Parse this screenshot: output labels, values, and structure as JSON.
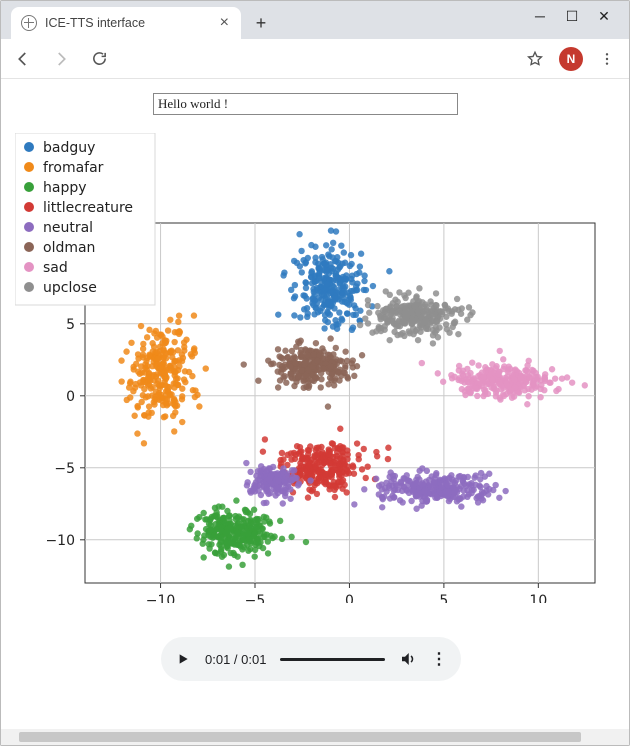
{
  "window": {
    "tab_title": "ICE-TTS interface",
    "avatar_letter": "N"
  },
  "page": {
    "input_value": "Hello world !"
  },
  "audio": {
    "time_display": "0:01 / 0:01"
  },
  "chart_data": {
    "type": "scatter",
    "title": "",
    "xlabel": "",
    "ylabel": "",
    "xlim": [
      -14,
      13
    ],
    "ylim": [
      -13,
      12
    ],
    "x_ticks": [
      -10,
      -5,
      0,
      5,
      10
    ],
    "y_ticks": [
      -10,
      -5,
      0,
      5
    ],
    "grid": true,
    "legend_position": "upper-left",
    "series": [
      {
        "name": "badguy",
        "color": "#2f7abf",
        "center": [
          -1.0,
          7.5
        ],
        "spread": [
          2.0,
          3.0
        ]
      },
      {
        "name": "fromafar",
        "color": "#f08a1a",
        "center": [
          -10.0,
          1.5
        ],
        "spread": [
          1.8,
          3.5
        ]
      },
      {
        "name": "happy",
        "color": "#38a03a",
        "center": [
          -6.0,
          -9.5
        ],
        "spread": [
          2.2,
          1.8
        ]
      },
      {
        "name": "littlecreature",
        "color": "#d23a35",
        "center": [
          -1.5,
          -5.0
        ],
        "spread": [
          2.5,
          1.8
        ]
      },
      {
        "name": "neutral",
        "color": "#8d6cbf",
        "center": [
          4.5,
          -6.5
        ],
        "spread": [
          3.2,
          1.2
        ]
      },
      {
        "name": "oldman",
        "color": "#8b6557",
        "center": [
          -2.0,
          2.0
        ],
        "spread": [
          2.0,
          1.5
        ]
      },
      {
        "name": "sad",
        "color": "#e493c3",
        "center": [
          8.0,
          1.0
        ],
        "spread": [
          3.0,
          1.2
        ]
      },
      {
        "name": "upclose",
        "color": "#8f8f8f",
        "center": [
          3.5,
          5.5
        ],
        "spread": [
          2.5,
          1.5
        ]
      }
    ],
    "extra_clusters": [
      {
        "series": "neutral",
        "center": [
          -4.0,
          -6.0
        ],
        "spread": [
          1.4,
          1.2
        ]
      }
    ]
  }
}
